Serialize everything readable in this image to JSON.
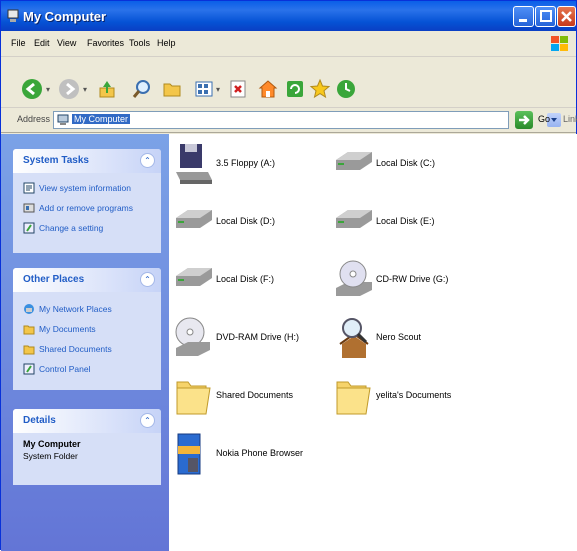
{
  "window": {
    "title": "My Computer"
  },
  "menu": {
    "items": [
      "File",
      "Edit",
      "View",
      "Favorites",
      "Tools",
      "Help"
    ]
  },
  "toolbar": {
    "icons": [
      "back-arrow-icon",
      "forward-arrow-icon",
      "up-folder-icon",
      "search-icon",
      "folders-icon",
      "views-icon",
      "delete-icon",
      "home-icon",
      "refresh-icon",
      "favorites-star-icon",
      "history-icon"
    ]
  },
  "address": {
    "label": "Address",
    "value": "My Computer",
    "go_label": "Go",
    "links_label": "Links"
  },
  "panels": {
    "system_tasks": {
      "title": "System Tasks",
      "items": [
        "View system information",
        "Add or remove programs",
        "Change a setting"
      ]
    },
    "other_places": {
      "title": "Other Places",
      "items": [
        "My Network Places",
        "My Documents",
        "Shared Documents",
        "Control Panel"
      ]
    },
    "details": {
      "title": "Details",
      "name": "My Computer",
      "subtitle": "System Folder"
    }
  },
  "items": [
    {
      "label": "3.5 Floppy (A:)",
      "icon": "floppy-drive-icon"
    },
    {
      "label": "Local Disk (C:)",
      "icon": "hard-disk-icon"
    },
    {
      "label": "Local Disk (D:)",
      "icon": "hard-disk-icon"
    },
    {
      "label": "Local Disk (E:)",
      "icon": "hard-disk-icon"
    },
    {
      "label": "Local Disk (F:)",
      "icon": "hard-disk-icon"
    },
    {
      "label": "CD-RW Drive (G:)",
      "icon": "cd-drive-icon"
    },
    {
      "label": "DVD-RAM Drive (H:)",
      "icon": "dvd-drive-icon"
    },
    {
      "label": "Nero Scout",
      "icon": "nero-scout-icon"
    },
    {
      "label": "Shared Documents",
      "icon": "folder-icon"
    },
    {
      "label": "yelita's Documents",
      "icon": "folder-icon"
    },
    {
      "label": "Nokia Phone Browser",
      "icon": "phone-browser-icon"
    }
  ],
  "colors": {
    "titlebar": "#0a5fe8",
    "task_pane": "#6375d6",
    "panel_link": "#215dc6",
    "selection": "#316ac5"
  }
}
